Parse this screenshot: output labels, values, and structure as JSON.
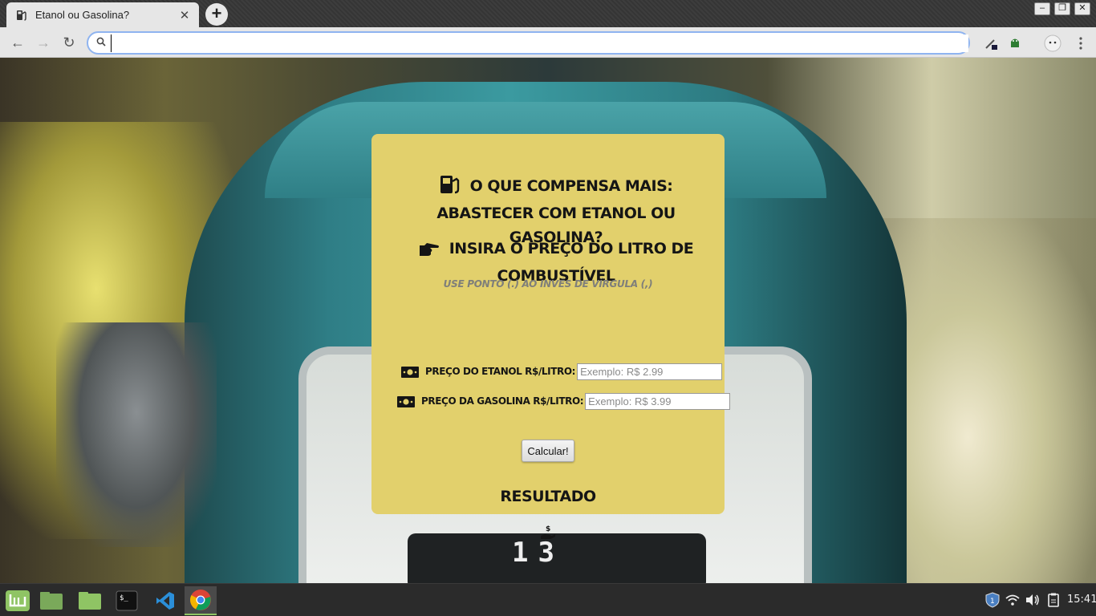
{
  "browser": {
    "tab_title": "Etanol ou Gasolina?",
    "tab_close": "✕",
    "new_tab": "+",
    "url": "",
    "window_controls": {
      "minimize": "–",
      "restore": "❐",
      "close": "✕"
    },
    "nav": {
      "back": "←",
      "forward": "→",
      "reload": "↻"
    }
  },
  "card": {
    "question_heading": "O que compensa mais: abastecer com etanol ou gasolina?",
    "insert_heading": "Insira o preço do litro de combustível",
    "hint": "Use ponto (.) ao invés de vírgula (,)",
    "fields": [
      {
        "label": "Preço do Etanol R$/Litro:",
        "placeholder": "Exemplo: R$ 2.99",
        "value": ""
      },
      {
        "label": "Preço da Gasolina R$/Litro:",
        "placeholder": "Exemplo: R$ 3.99",
        "value": ""
      }
    ],
    "calculate_button": "Calcular!",
    "result_heading": "Resultado",
    "icons": [
      "gas-pump-icon",
      "pointing-hand-icon",
      "money-bill-icon",
      "hand-holding-usd-icon"
    ]
  },
  "background": {
    "counter_text": "13"
  },
  "taskbar": {
    "clock": "15:41",
    "apps": [
      "mint-menu-icon",
      "files-icon",
      "folder-icon",
      "terminal-icon",
      "vscode-icon",
      "chrome-icon"
    ]
  },
  "colors": {
    "card": "#e2d06c",
    "heading": "#151515",
    "hint": "#7f7f7a",
    "taskbar": "#2b2b2b",
    "chrome_toolbar": "#e6e6e6",
    "omnibox_focus": "#8fb4f0"
  }
}
